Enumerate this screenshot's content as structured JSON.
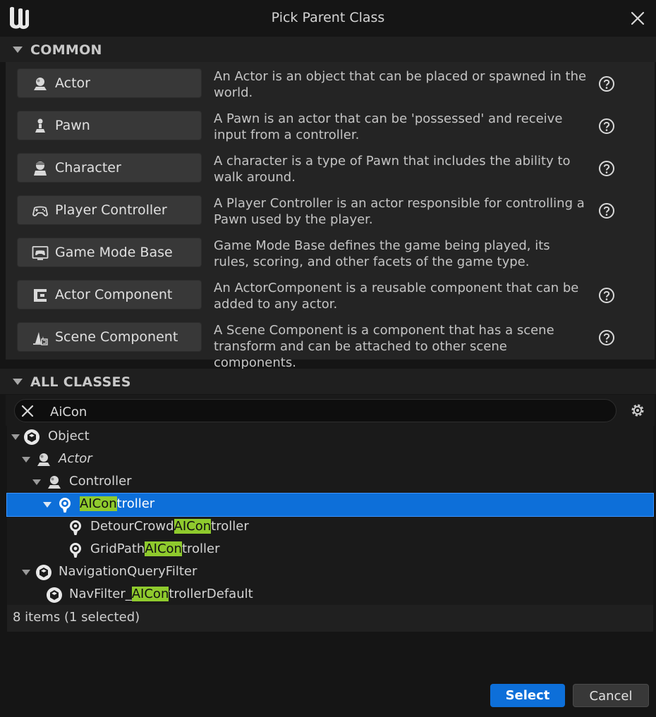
{
  "window": {
    "title": "Pick Parent Class"
  },
  "common": {
    "header": "COMMON",
    "items": [
      {
        "label": "Actor",
        "icon": "actor-icon",
        "description": "An Actor is an object that can be placed or spawned in the world.",
        "help": true
      },
      {
        "label": "Pawn",
        "icon": "pawn-icon",
        "description": "A Pawn is an actor that can be 'possessed' and receive input from a controller.",
        "help": true
      },
      {
        "label": "Character",
        "icon": "character-icon",
        "description": "A character is a type of Pawn that includes the ability to walk around.",
        "help": true
      },
      {
        "label": "Player Controller",
        "icon": "gamepad-icon",
        "description": "A Player Controller is an actor responsible for controlling a Pawn used by the player.",
        "help": true
      },
      {
        "label": "Game Mode Base",
        "icon": "game-mode-icon",
        "description": "Game Mode Base defines the game being played, its rules, scoring, and other facets of the game type.",
        "help": false
      },
      {
        "label": "Actor Component",
        "icon": "actor-component-icon",
        "description": "An ActorComponent is a reusable component that can be added to any actor.",
        "help": true
      },
      {
        "label": "Scene Component",
        "icon": "scene-component-icon",
        "description": "A Scene Component is a component that has a scene transform and can be attached to other scene components.",
        "help": true
      }
    ]
  },
  "all_classes": {
    "header": "ALL CLASSES",
    "search_value": "AiCon",
    "tree": [
      {
        "pre": "Object",
        "hl": "",
        "post": "",
        "icon": "object-icon",
        "italic": false,
        "selected": false,
        "expanded": true
      },
      {
        "pre": "Actor",
        "hl": "",
        "post": "",
        "icon": "actor-icon",
        "italic": true,
        "selected": false,
        "expanded": true
      },
      {
        "pre": "Controller",
        "hl": "",
        "post": "",
        "icon": "actor-icon",
        "italic": false,
        "selected": false,
        "expanded": true
      },
      {
        "pre": "",
        "hl": "AICon",
        "post": "troller",
        "icon": "ai-controller-icon",
        "italic": false,
        "selected": true,
        "expanded": true
      },
      {
        "pre": "DetourCrowd",
        "hl": "AICon",
        "post": "troller",
        "icon": "ai-controller-icon",
        "italic": false,
        "selected": false,
        "expanded": false
      },
      {
        "pre": "GridPath",
        "hl": "AICon",
        "post": "troller",
        "icon": "ai-controller-icon",
        "italic": false,
        "selected": false,
        "expanded": false
      },
      {
        "pre": "NavigationQueryFilter",
        "hl": "",
        "post": "",
        "icon": "object-icon",
        "italic": false,
        "selected": false,
        "expanded": true
      },
      {
        "pre": "NavFilter_",
        "hl": "AICon",
        "post": "trollerDefault",
        "icon": "object-icon",
        "italic": false,
        "selected": false,
        "expanded": false
      }
    ],
    "status": "8 items (1 selected)"
  },
  "footer": {
    "select_label": "Select",
    "cancel_label": "Cancel"
  },
  "colors": {
    "accent": "#0d6fd9",
    "highlight": "#8fca2d",
    "background": "#151515"
  }
}
